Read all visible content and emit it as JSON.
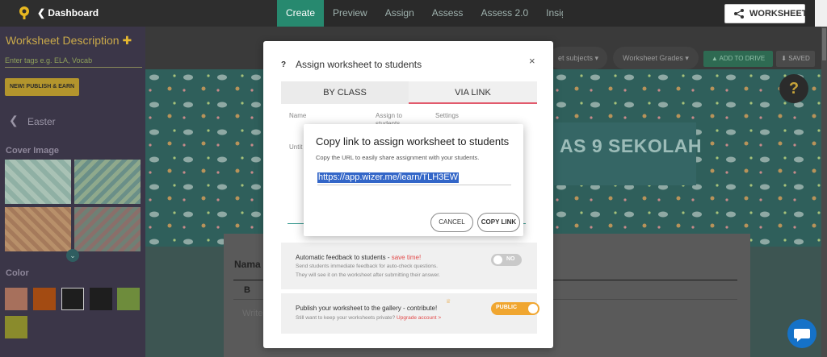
{
  "topbar": {
    "back_label": "Dashboard",
    "tabs": [
      "Create",
      "Preview",
      "Assign",
      "Assess",
      "Assess 2.0",
      "Insights"
    ],
    "active_tab": "Create",
    "worksheet_button": "WORKSHEET"
  },
  "sidebar": {
    "worksheet_description": "Worksheet Description",
    "tags_placeholder": "Enter tags e.g. ELA, Vocab",
    "publish_button": "NEW! PUBLISH & EARN",
    "theme_name": "Easter",
    "cover_image_label": "Cover Image",
    "color_label": "Color",
    "swatches": [
      "#a7705c",
      "#a34b12",
      "#1e1e1e",
      "#1e1e1e",
      "#6e8c3c",
      "#8a8b2c"
    ]
  },
  "toolbar": {
    "subjects_label": "et subjects",
    "grades_label": "Worksheet Grades",
    "add_to_drive": "ADD TO DRIVE",
    "saved": "SAVED"
  },
  "canvas": {
    "title_text": "AS 9 SEKOLAH",
    "nama_label": "Nama",
    "bold_button": "B",
    "write_placeholder": "Write"
  },
  "modal": {
    "title": "Assign worksheet to students",
    "tabs": [
      "BY CLASS",
      "VIA LINK"
    ],
    "active_tab": "VIA LINK",
    "columns": [
      "Name",
      "Assign to students",
      "Settings"
    ],
    "row_name": "Untit",
    "feedback": {
      "title": "Automatic feedback to students - ",
      "highlight": "save time!",
      "sub1": "Send students immediate feedback for auto-check questions.",
      "sub2": "They will see it on the worksheet after submitting their answer.",
      "toggle": "NO"
    },
    "publish": {
      "title": "Publish your worksheet to the gallery - contribute!",
      "sub": "Still want to keep your worksheets private? ",
      "upgrade": "Upgrade account",
      "toggle": "PUBLIC"
    }
  },
  "copy_dialog": {
    "title": "Copy link to assign worksheet to students",
    "subtitle": "Copy the URL to easily share assignment with your students.",
    "url": "https://app.wizer.me/learn/TLH3EW",
    "cancel": "CANCEL",
    "copy": "COPY LINK"
  },
  "icons": [
    "logo-icon",
    "chevron-left-icon",
    "share-icon",
    "close-icon",
    "question-icon",
    "chat-icon",
    "help-icon",
    "crown-icon",
    "drive-icon",
    "download-icon"
  ]
}
